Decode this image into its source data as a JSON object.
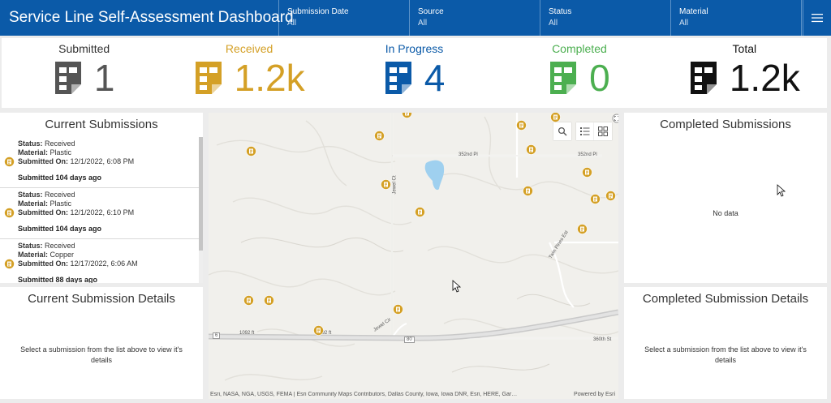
{
  "header": {
    "title": "Service Line Self-Assessment Dashboard",
    "filters": [
      {
        "label": "Submission Date",
        "value": "All"
      },
      {
        "label": "Source",
        "value": "All"
      },
      {
        "label": "Status",
        "value": "All"
      },
      {
        "label": "Material",
        "value": "All"
      }
    ],
    "menu_icon": "hamburger-icon"
  },
  "indicators": [
    {
      "label": "Submitted",
      "value": "1",
      "color": "#555555"
    },
    {
      "label": "Received",
      "value": "1.2k",
      "color": "#d4a026"
    },
    {
      "label": "In Progress",
      "value": "4",
      "color": "#0b5aa8"
    },
    {
      "label": "Completed",
      "value": "0",
      "color": "#4caf50"
    },
    {
      "label": "Total",
      "value": "1.2k",
      "color": "#111111"
    }
  ],
  "current_submissions": {
    "title": "Current Submissions",
    "status_label": "Status:",
    "material_label": "Material:",
    "submitted_label": "Submitted On:",
    "items": [
      {
        "status": "Received",
        "material": "Plastic",
        "submitted_on": "12/1/2022, 6:08 PM",
        "ago": "Submitted 104 days ago"
      },
      {
        "status": "Received",
        "material": "Plastic",
        "submitted_on": "12/1/2022, 6:10 PM",
        "ago": "Submitted 104 days ago"
      },
      {
        "status": "Received",
        "material": "Copper",
        "submitted_on": "12/17/2022, 6:06 AM",
        "ago": "Submitted 88 days ago"
      }
    ]
  },
  "current_details": {
    "title": "Current Submission Details",
    "message": "Select a submission from the list above to view it's details"
  },
  "completed_submissions": {
    "title": "Completed Submissions",
    "message": "No data"
  },
  "completed_details": {
    "title": "Completed Submission Details",
    "message": "Select a submission from the list above to view it's details"
  },
  "map": {
    "attribution": "Esri, NASA, NGA, USGS, FEMA | Esri Community Maps Contributors, Dallas County, Iowa, Iowa DNR, Esri, HERE, Gar…",
    "powered_by": "Powered by Esri",
    "road_labels": {
      "r352_left": "352nd Pl",
      "r352_right": "352nd Pl",
      "jewel_ct": "Jewel Ct",
      "jewel_cir": "Jewel Cir",
      "twin_pines": "Twin Pines Est",
      "r360": "360th St",
      "r1092": "1092 ft",
      "hwy6": "6",
      "hwy80": "80"
    },
    "tool_icons": [
      "search-icon",
      "legend-list-icon",
      "basemap-grid-icon"
    ],
    "marker_color": "#d4a026"
  }
}
